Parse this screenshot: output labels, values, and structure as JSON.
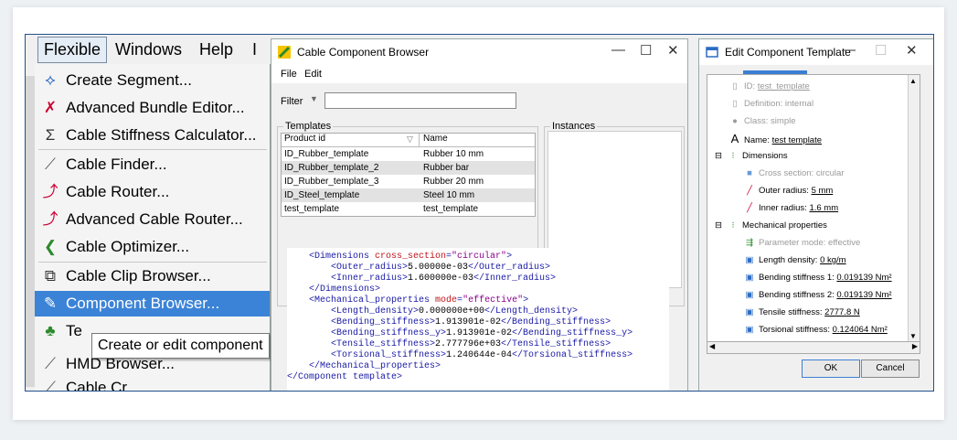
{
  "menubar": {
    "flexible": "Flexible",
    "windows": "Windows",
    "help": "Help",
    "cut": "I"
  },
  "menu": {
    "items": [
      {
        "label": "Create Segment...",
        "icon": "⟡"
      },
      {
        "label": "Advanced Bundle Editor...",
        "icon": "✗"
      },
      {
        "label": "Cable Stiffness Calculator...",
        "icon": "Σ"
      },
      {
        "label": "Cable Finder...",
        "icon": "⟋"
      },
      {
        "label": "Cable Router...",
        "icon": "⤴"
      },
      {
        "label": "Advanced Cable Router...",
        "icon": "⤴"
      },
      {
        "label": "Cable Optimizer...",
        "icon": "❮"
      },
      {
        "label": "Cable Clip Browser...",
        "icon": "⧉"
      },
      {
        "label": "Component Browser...",
        "icon": "✎"
      },
      {
        "label": "Te",
        "icon": "♣"
      },
      {
        "label": "HMD Browser...",
        "icon": "⟋"
      },
      {
        "label": "Cable Cr",
        "icon": "⟋"
      }
    ],
    "tooltip": "Create or edit component"
  },
  "browser": {
    "title": "Cable Component Browser",
    "menu_file": "File",
    "menu_edit": "Edit",
    "filter_label": "Filter",
    "templates_label": "Templates",
    "instances_label": "Instances",
    "columns": [
      "Product id",
      "Name"
    ],
    "rows": [
      [
        "ID_Rubber_template",
        "Rubber 10 mm"
      ],
      [
        "ID_Rubber_template_2",
        "Rubber bar"
      ],
      [
        "ID_Rubber_template_3",
        "Rubber 20 mm"
      ],
      [
        "ID_Steel_template",
        "Steel 10 mm"
      ],
      [
        "test_template",
        "test_template"
      ]
    ]
  },
  "xml": {
    "l1_tag": "<Dimensions ",
    "l1_attr": "cross_section",
    "l1_eq": "=",
    "l1_val": "\"circular\"",
    "l1_close": ">",
    "l2a": "<Outer_radius>",
    "l2b": "5.00000e-03",
    "l2c": "</Outer_radius>",
    "l3a": "<Inner_radius>",
    "l3b": "1.600000e-03",
    "l3c": "</Inner_radius>",
    "l4": "</Dimensions>",
    "l5_tag": "<Mechanical_properties ",
    "l5_attr": "mode",
    "l5_eq": "=",
    "l5_val": "\"effective\"",
    "l5_close": ">",
    "l6a": "<Length_density>",
    "l6b": "0.000000e+00",
    "l6c": "</Length_density>",
    "l7a": "<Bending_stiffness>",
    "l7b": "1.913901e-02",
    "l7c": "</Bending_stiffness>",
    "l8a": "<Bending_stiffness_y>",
    "l8b": "1.913901e-02",
    "l8c": "</Bending_stiffness_y>",
    "l9a": "<Tensile_stiffness>",
    "l9b": "2.777796e+03",
    "l9c": "</Tensile_stiffness>",
    "l10a": "<Torsional_stiffness>",
    "l10b": "1.240644e-04",
    "l10c": "</Torsional_stiffness>",
    "l11": "</Mechanical_properties>",
    "l12": "</Component template>"
  },
  "editor": {
    "title": "Edit Component Template",
    "id_label": "ID:",
    "id_value": "test_template",
    "def_label": "Definition:",
    "def_value": "internal",
    "class_label": "Class:",
    "class_value": "simple",
    "name_label": "Name:",
    "name_value": "test template",
    "dimensions": "Dimensions",
    "cross_label": "Cross section:",
    "cross_value": "circular",
    "outer_label": "Outer radius:",
    "outer_value": "5 mm",
    "inner_label": "Inner radius:",
    "inner_value": "1.6 mm",
    "mech": "Mechanical properties",
    "param_label": "Parameter mode:",
    "param_value": "effective",
    "ld_label": "Length density:",
    "ld_value": "0 kg/m",
    "bs1_label": "Bending stiffness 1:",
    "bs1_value": "0.019139 Nm²",
    "bs2_label": "Bending stiffness 2:",
    "bs2_value": "0.019139 Nm²",
    "ts_label": "Tensile stiffness:",
    "ts_value": "2777.8 N",
    "tor_label": "Torsional stiffness:",
    "tor_value": "0.124064 Nm²",
    "ok": "OK",
    "cancel": "Cancel"
  }
}
